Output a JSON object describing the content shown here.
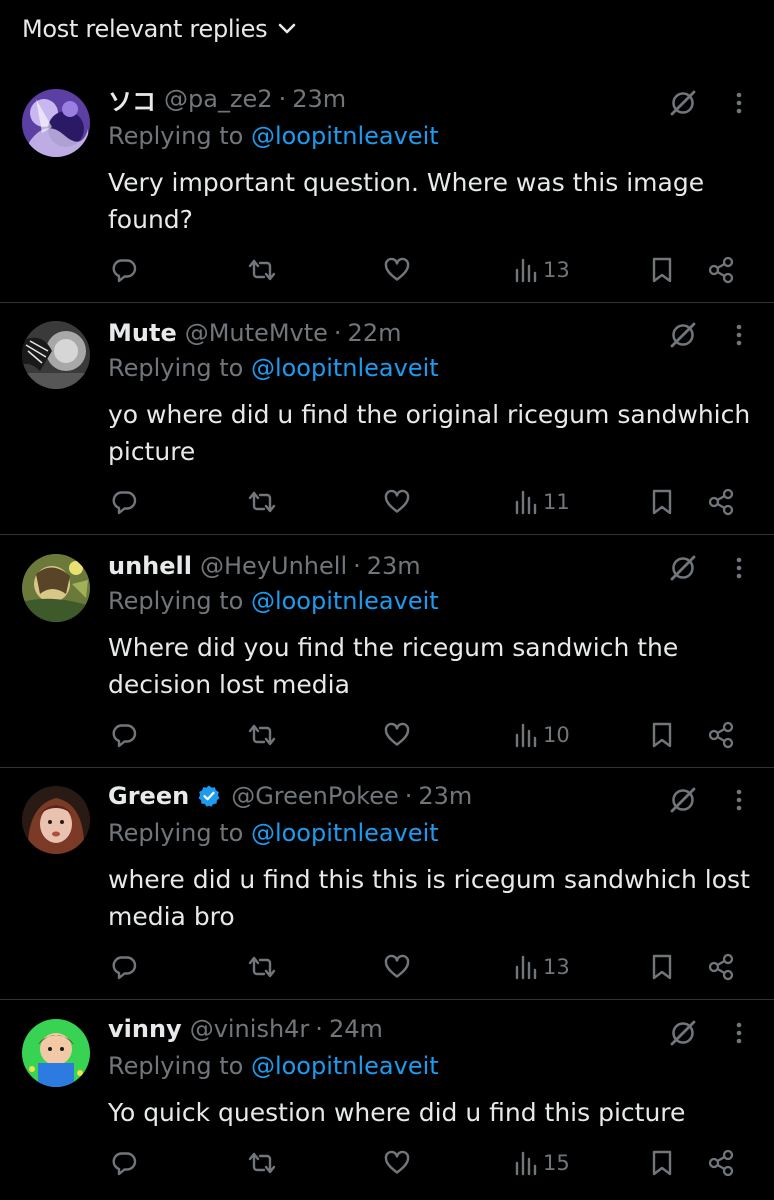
{
  "header": {
    "sort_label": "Most relevant replies"
  },
  "colors": {
    "background": "#000000",
    "text": "#e7e9ea",
    "muted": "#71767b",
    "link": "#1d9bf0",
    "divider": "#2f3336",
    "verified": "#1d9bf0"
  },
  "replies": [
    {
      "display_name": "ソコ",
      "handle": "@pa_ze2",
      "separator": "·",
      "time": "23m",
      "replying_prefix": "Replying to ",
      "replying_to": "@loopitnleaveit",
      "text": "Very important question. Where was this image found?",
      "views": "13",
      "verified": false
    },
    {
      "display_name": "Mute",
      "handle": "@MuteMvte",
      "separator": "·",
      "time": "22m",
      "replying_prefix": "Replying to ",
      "replying_to": "@loopitnleaveit",
      "text": "yo where did u find the original ricegum sandwhich picture",
      "views": "11",
      "verified": false
    },
    {
      "display_name": "unhell",
      "handle": "@HeyUnhell",
      "separator": "·",
      "time": "23m",
      "replying_prefix": "Replying to ",
      "replying_to": "@loopitnleaveit",
      "text": "Where did you find the ricegum sandwich the decision lost media",
      "views": "10",
      "verified": false
    },
    {
      "display_name": "Green",
      "handle": "@GreenPokee",
      "separator": "·",
      "time": "23m",
      "replying_prefix": "Replying to ",
      "replying_to": "@loopitnleaveit",
      "text": "where did u find this this is ricegum sandwhich lost media bro",
      "views": "13",
      "verified": true
    },
    {
      "display_name": "vinny",
      "handle": "@vinish4r",
      "separator": "·",
      "time": "24m",
      "replying_prefix": "Replying to ",
      "replying_to": "@loopitnleaveit",
      "text": "Yo quick question where did u find this picture",
      "views": "15",
      "verified": false
    }
  ],
  "icons": {
    "sort": "chevron-down-icon",
    "grok": "grok-icon",
    "more": "more-options-icon",
    "reply": "reply-icon",
    "repost": "repost-icon",
    "like": "like-icon",
    "views": "views-icon",
    "bookmark": "bookmark-icon",
    "share": "share-icon",
    "verified": "verified-badge-icon"
  }
}
